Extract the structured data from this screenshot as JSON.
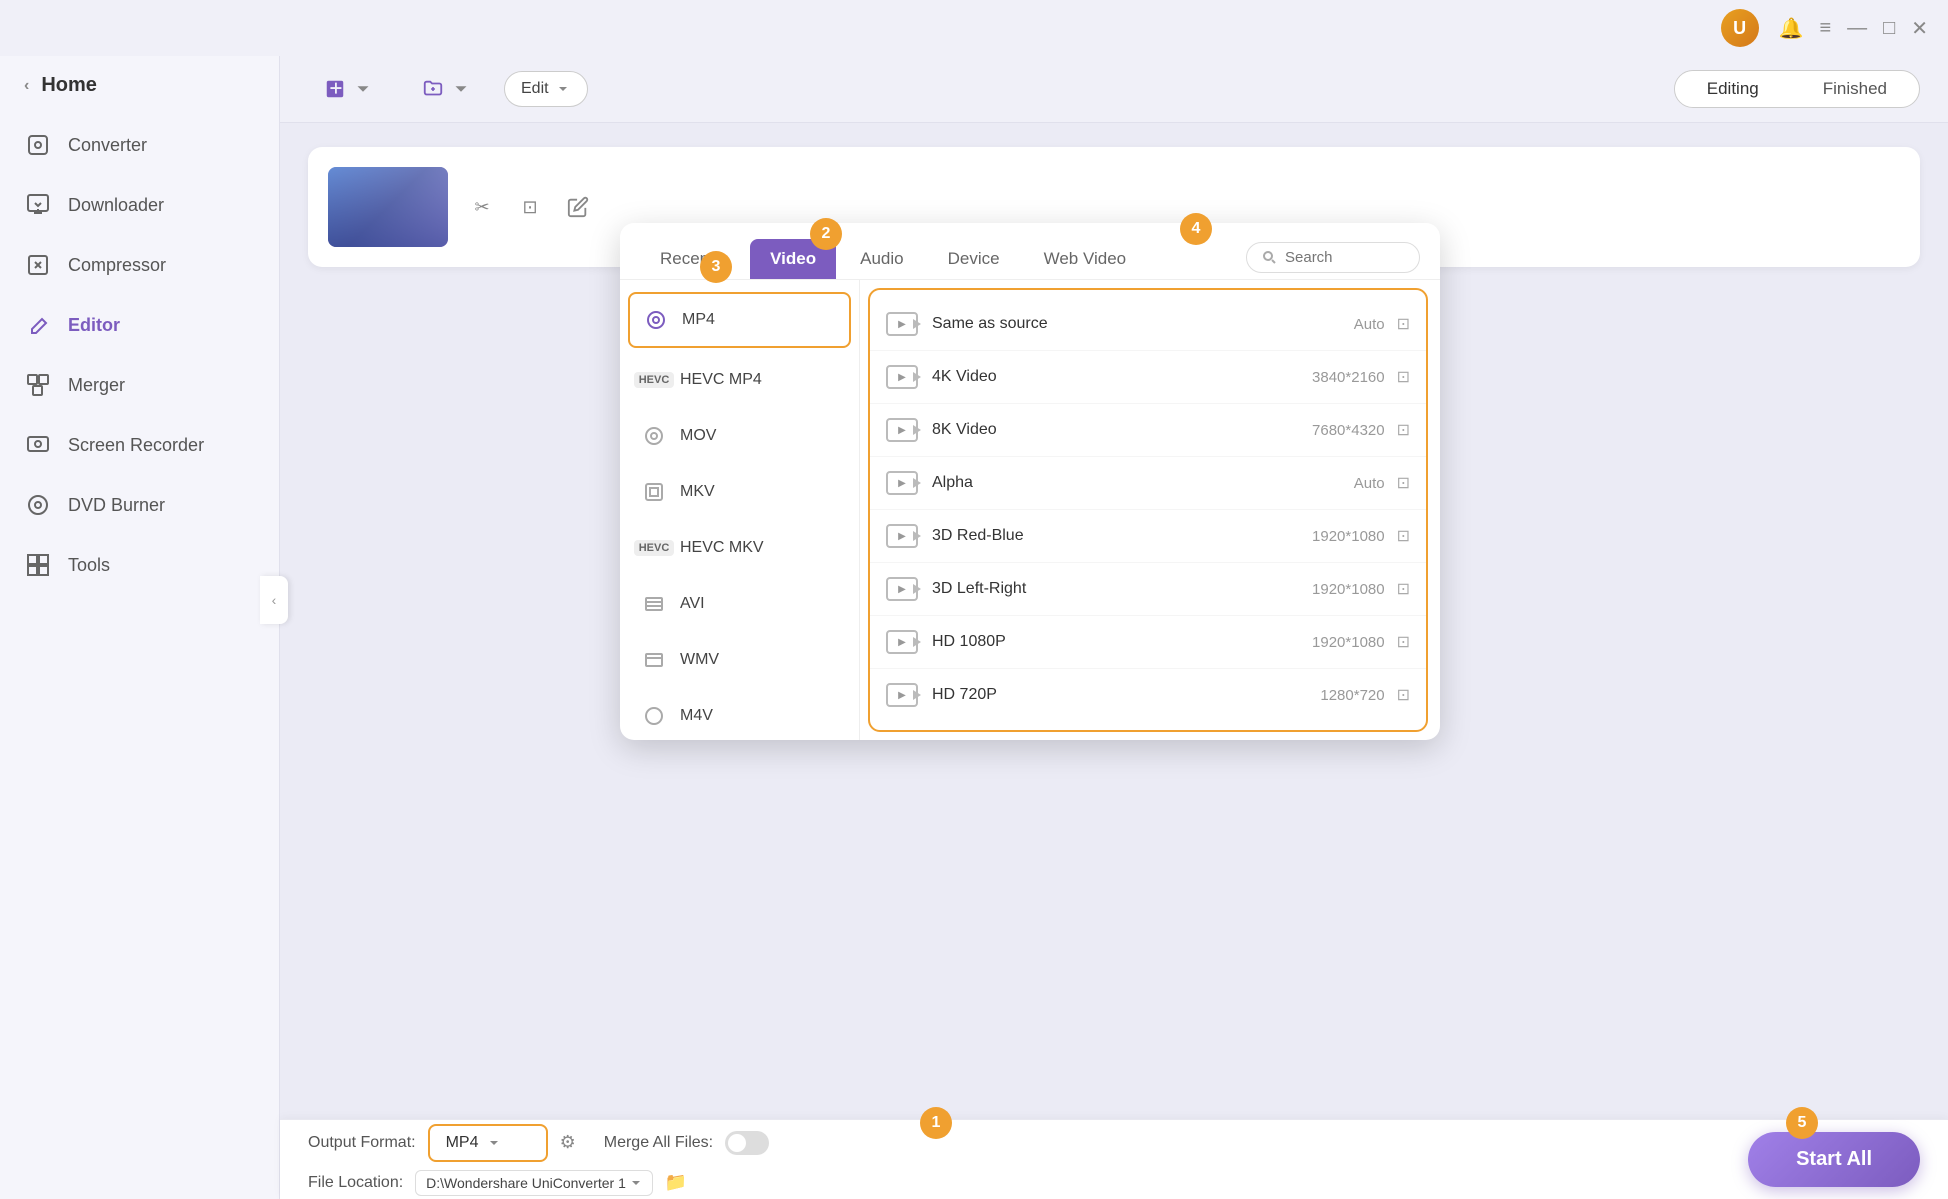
{
  "titlebar": {
    "user_initial": "U",
    "controls": [
      "bell",
      "menu",
      "minimize",
      "maximize",
      "close"
    ]
  },
  "sidebar": {
    "back_label": "‹",
    "home_label": "Home",
    "items": [
      {
        "id": "converter",
        "label": "Converter",
        "icon": "⊡",
        "active": false
      },
      {
        "id": "downloader",
        "label": "Downloader",
        "icon": "⬇",
        "active": false
      },
      {
        "id": "compressor",
        "label": "Compressor",
        "icon": "⬜",
        "active": false
      },
      {
        "id": "editor",
        "label": "Editor",
        "icon": "✂",
        "active": true
      },
      {
        "id": "merger",
        "label": "Merger",
        "icon": "⧉",
        "active": false
      },
      {
        "id": "screen-recorder",
        "label": "Screen Recorder",
        "icon": "⊙",
        "active": false
      },
      {
        "id": "dvd-burner",
        "label": "DVD Burner",
        "icon": "⊙",
        "active": false
      },
      {
        "id": "tools",
        "label": "Tools",
        "icon": "⠿",
        "active": false
      }
    ],
    "collapse_icon": "‹"
  },
  "toolbar": {
    "add_btn1_label": "✚",
    "add_btn2_label": "✚",
    "edit_dropdown_label": "Edit",
    "tab_editing": "Editing",
    "tab_finished": "Finished"
  },
  "format_panel": {
    "tabs": [
      {
        "id": "recently",
        "label": "Recently"
      },
      {
        "id": "video",
        "label": "Video",
        "active": true
      },
      {
        "id": "audio",
        "label": "Audio"
      },
      {
        "id": "device",
        "label": "Device"
      },
      {
        "id": "web-video",
        "label": "Web Video"
      }
    ],
    "search_placeholder": "Search",
    "formats": [
      {
        "id": "mp4",
        "label": "MP4",
        "icon": "○",
        "active": true
      },
      {
        "id": "hevc-mp4",
        "label": "HEVC MP4",
        "icon": "hevc",
        "active": false
      },
      {
        "id": "mov",
        "label": "MOV",
        "icon": "○",
        "active": false
      },
      {
        "id": "mkv",
        "label": "MKV",
        "icon": "▣",
        "active": false
      },
      {
        "id": "hevc-mkv",
        "label": "HEVC MKV",
        "icon": "hevc",
        "active": false
      },
      {
        "id": "avi",
        "label": "AVI",
        "icon": "▦",
        "active": false
      },
      {
        "id": "wmv",
        "label": "WMV",
        "icon": "▦",
        "active": false
      },
      {
        "id": "m4v",
        "label": "M4V",
        "icon": "○",
        "active": false
      }
    ],
    "presets": [
      {
        "id": "same-as-source",
        "label": "Same as source",
        "resolution": "Auto"
      },
      {
        "id": "4k-video",
        "label": "4K Video",
        "resolution": "3840*2160"
      },
      {
        "id": "8k-video",
        "label": "8K Video",
        "resolution": "7680*4320"
      },
      {
        "id": "alpha",
        "label": "Alpha",
        "resolution": "Auto"
      },
      {
        "id": "3d-red-blue",
        "label": "3D Red-Blue",
        "resolution": "1920*1080"
      },
      {
        "id": "3d-left-right",
        "label": "3D Left-Right",
        "resolution": "1920*1080"
      },
      {
        "id": "hd-1080p",
        "label": "HD 1080P",
        "resolution": "1920*1080"
      },
      {
        "id": "hd-720p",
        "label": "HD 720P",
        "resolution": "1280*720"
      }
    ]
  },
  "bottom_bar": {
    "output_format_label": "Output Format:",
    "output_format_value": "MP4",
    "merge_files_label": "Merge All Files:",
    "file_location_label": "File Location:",
    "file_path": "D:\\Wondershare UniConverter 1",
    "start_all_label": "Start All"
  },
  "steps": {
    "s1": "1",
    "s2": "2",
    "s3": "3",
    "s4": "4",
    "s5": "5"
  }
}
